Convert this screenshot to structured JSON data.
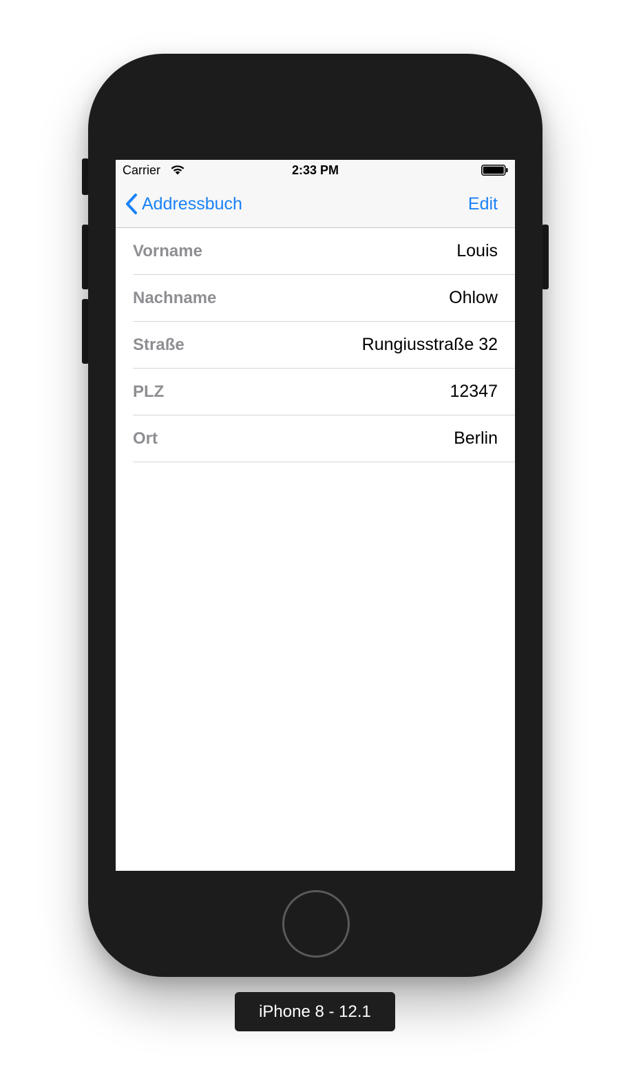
{
  "status_bar": {
    "carrier": "Carrier",
    "wifi_icon": "wifi-icon",
    "time": "2:33 PM",
    "battery_icon": "battery-full-icon"
  },
  "nav_bar": {
    "back_label": "Addressbuch",
    "back_icon": "chevron-left-icon",
    "edit_label": "Edit",
    "tint_color": "#1a82f7"
  },
  "detail_rows": [
    {
      "label": "Vorname",
      "value": "Louis"
    },
    {
      "label": "Nachname",
      "value": "Ohlow"
    },
    {
      "label": "Straße",
      "value": "Rungiusstraße 32"
    },
    {
      "label": "PLZ",
      "value": "12347"
    },
    {
      "label": "Ort",
      "value": "Berlin"
    }
  ],
  "simulator": {
    "device_label": "iPhone 8 - 12.1"
  }
}
